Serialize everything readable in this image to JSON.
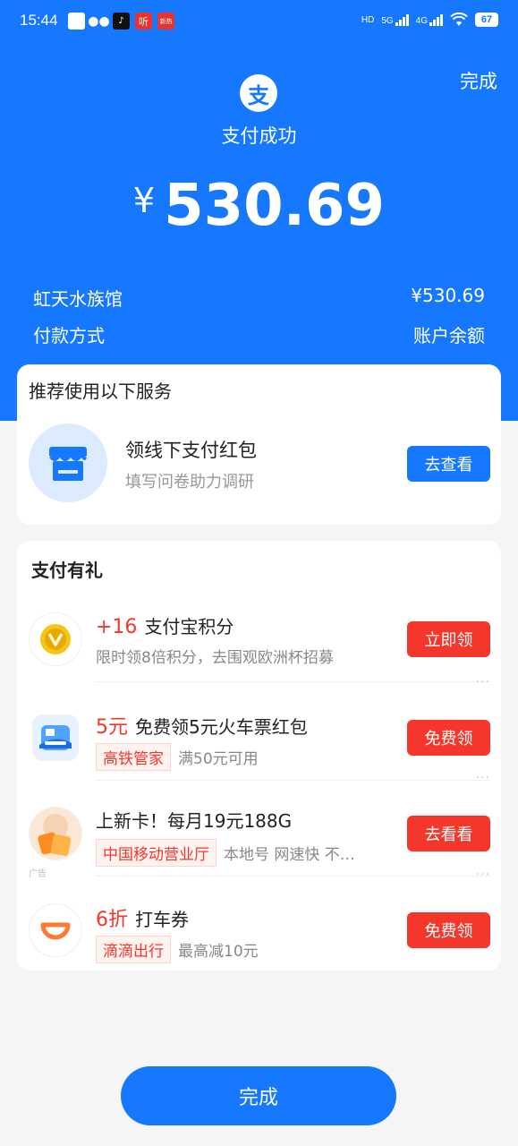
{
  "status_bar": {
    "time": "15:44",
    "listen_badge": "听",
    "news_badge": "新热",
    "network_hd": "HD",
    "network_5g": "5G",
    "network_4g": "4G",
    "battery": "67"
  },
  "header": {
    "done_label": "完成",
    "logo_char": "支",
    "title": "支付成功",
    "currency": "¥",
    "amount": "530.69"
  },
  "details": {
    "merchant": "虹天水族馆",
    "merchant_amount": "¥530.69",
    "pay_method_label": "付款方式",
    "pay_method_value": "账户余额"
  },
  "services": {
    "title": "推荐使用以下服务",
    "item": {
      "name": "领线下支付红包",
      "desc": "填写问卷助力调研",
      "button": "去查看"
    }
  },
  "gifts": {
    "title": "支付有礼",
    "items": [
      {
        "highlight": "+16",
        "name": "支付宝积分",
        "desc": "限时领8倍积分，去围观欧洲杯招募",
        "button": "立即领",
        "icon": "coin-icon"
      },
      {
        "highlight": "5元",
        "name": "免费领5元火车票红包",
        "tag": "高铁管家",
        "desc": "满50元可用",
        "button": "免费领",
        "icon": "train-icon"
      },
      {
        "name": "上新卡！每月19元188G",
        "tag": "中国移动营业厅",
        "desc": "本地号 网速快 不…",
        "button": "去看看",
        "icon": "mobile-card-icon",
        "ad_label": "广告"
      },
      {
        "highlight": "6折",
        "name": "打车券",
        "tag": "滴滴出行",
        "desc": "最高减10元",
        "button": "免费领",
        "icon": "didi-icon"
      }
    ],
    "more": "···"
  },
  "footer": {
    "done_label": "完成"
  },
  "colors": {
    "brand_blue": "#1677ff",
    "action_red": "#f5362b",
    "background": "#f5f5f5"
  }
}
